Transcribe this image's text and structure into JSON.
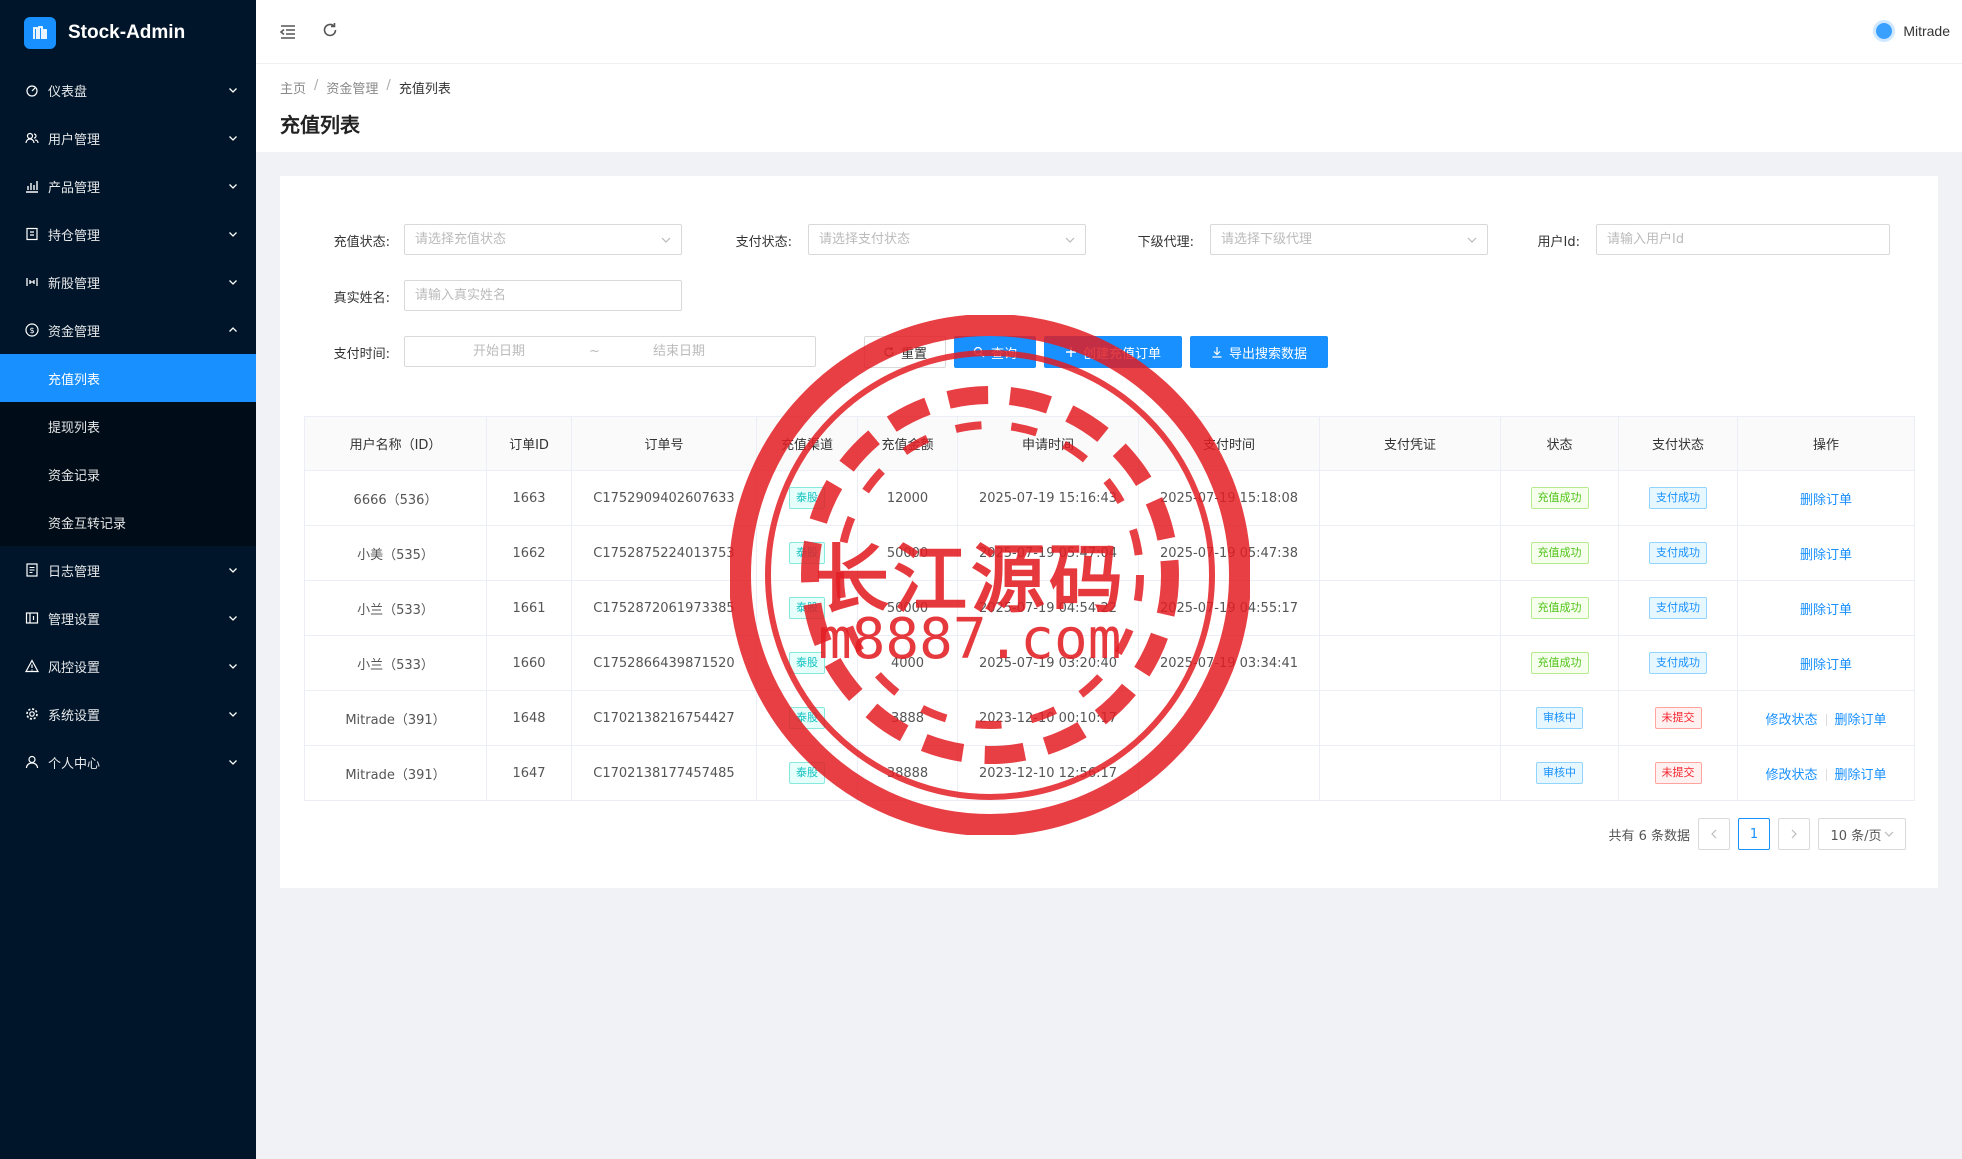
{
  "app": {
    "title": "Stock-Admin"
  },
  "sidebar": {
    "items": [
      {
        "label": "仪表盘",
        "icon": "dashboard-icon"
      },
      {
        "label": "用户管理",
        "icon": "users-icon"
      },
      {
        "label": "产品管理",
        "icon": "chart-icon"
      },
      {
        "label": "持仓管理",
        "icon": "position-icon"
      },
      {
        "label": "新股管理",
        "icon": "ipo-icon"
      },
      {
        "label": "资金管理",
        "icon": "money-icon",
        "expanded": true
      }
    ],
    "submenu": [
      {
        "label": "充值列表",
        "active": true
      },
      {
        "label": "提现列表"
      },
      {
        "label": "资金记录"
      },
      {
        "label": "资金互转记录"
      }
    ],
    "items_after": [
      {
        "label": "日志管理",
        "icon": "log-icon"
      },
      {
        "label": "管理设置",
        "icon": "admin-icon"
      },
      {
        "label": "风控设置",
        "icon": "warning-icon"
      },
      {
        "label": "系统设置",
        "icon": "gear-icon"
      },
      {
        "label": "个人中心",
        "icon": "user-icon"
      }
    ]
  },
  "header": {
    "username": "Mitrade"
  },
  "breadcrumb": {
    "home": "主页",
    "parent": "资金管理",
    "current": "充值列表"
  },
  "page_title": "充值列表",
  "filters": {
    "recharge_status": {
      "label": "充值状态:",
      "placeholder": "请选择充值状态"
    },
    "pay_status": {
      "label": "支付状态:",
      "placeholder": "请选择支付状态"
    },
    "agent": {
      "label": "下级代理:",
      "placeholder": "请选择下级代理"
    },
    "user_id": {
      "label": "用户Id:",
      "placeholder": "请输入用户Id"
    },
    "real_name": {
      "label": "真实姓名:",
      "placeholder": "请输入真实姓名"
    },
    "pay_time": {
      "label": "支付时间:",
      "start": "开始日期",
      "sep": "~",
      "end": "结束日期"
    }
  },
  "buttons": {
    "reset": "重置",
    "search": "查询",
    "create": "创建充值订单",
    "export": "导出搜索数据"
  },
  "table": {
    "columns": [
      "用户名称（ID）",
      "订单ID",
      "订单号",
      "充值渠道",
      "充值金额",
      "申请时间",
      "支付时间",
      "支付凭证",
      "状态",
      "支付状态",
      "操作"
    ],
    "rows": [
      {
        "user": "6666（536）",
        "order_id": "1663",
        "order_no": "C1752909402607633",
        "channel": "泰股",
        "amount": "12000",
        "apply_time": "2025-07-19 15:16:43",
        "pay_time": "2025-07-19 15:18:08",
        "voucher": "",
        "status": "充值成功",
        "pay_status": "支付成功",
        "actions": [
          "删除订单"
        ]
      },
      {
        "user": "小美（535）",
        "order_id": "1662",
        "order_no": "C1752875224013753",
        "channel": "泰股",
        "amount": "50000",
        "apply_time": "2025-07-19 05:47:04",
        "pay_time": "2025-07-19 05:47:38",
        "voucher": "",
        "status": "充值成功",
        "pay_status": "支付成功",
        "actions": [
          "删除订单"
        ]
      },
      {
        "user": "小兰（533）",
        "order_id": "1661",
        "order_no": "C1752872061973385",
        "channel": "泰股",
        "amount": "50000",
        "apply_time": "2025-07-19 04:54:22",
        "pay_time": "2025-07-19 04:55:17",
        "voucher": "",
        "status": "充值成功",
        "pay_status": "支付成功",
        "actions": [
          "删除订单"
        ]
      },
      {
        "user": "小兰（533）",
        "order_id": "1660",
        "order_no": "C1752866439871520",
        "channel": "泰股",
        "amount": "4000",
        "apply_time": "2025-07-19 03:20:40",
        "pay_time": "2025-07-19 03:34:41",
        "voucher": "",
        "status": "充值成功",
        "pay_status": "支付成功",
        "actions": [
          "删除订单"
        ]
      },
      {
        "user": "Mitrade（391）",
        "order_id": "1648",
        "order_no": "C1702138216754427",
        "channel": "泰股",
        "amount": "3888",
        "apply_time": "2023-12-10 00:10:17",
        "pay_time": "",
        "voucher": "",
        "status": "审核中",
        "pay_status": "未提交",
        "actions": [
          "修改状态",
          "删除订单"
        ]
      },
      {
        "user": "Mitrade（391）",
        "order_id": "1647",
        "order_no": "C1702138177457485",
        "channel": "泰股",
        "amount": "38888",
        "apply_time": "2023-12-10 12:56:17",
        "pay_time": "",
        "voucher": "",
        "status": "审核中",
        "pay_status": "未提交",
        "actions": [
          "修改状态",
          "删除订单"
        ]
      }
    ]
  },
  "pagination": {
    "total_text": "共有 6 条数据",
    "current_page": "1",
    "page_size": "10 条/页"
  },
  "watermark": {
    "title": "长江源码",
    "url": "m8887.com"
  }
}
